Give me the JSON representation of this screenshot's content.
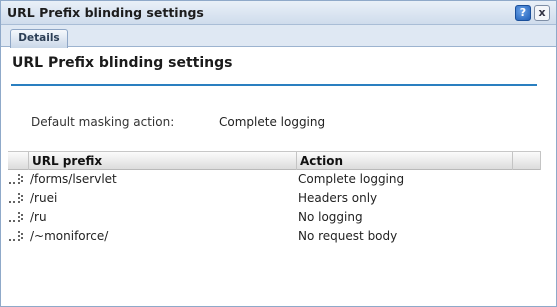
{
  "window": {
    "title": "URL Prefix blinding settings",
    "help_icon": "help-icon",
    "help_glyph": "?",
    "close_icon": "close-icon",
    "close_glyph": "x"
  },
  "tabs": [
    {
      "label": "Details",
      "active": true
    }
  ],
  "page": {
    "heading": "URL Prefix blinding settings",
    "accent_color": "#2a7fc0"
  },
  "default_masking": {
    "label": "Default masking action:",
    "value": "Complete logging"
  },
  "table": {
    "columns": [
      "URL prefix",
      "Action"
    ],
    "rows": [
      {
        "prefix": "/forms/lservlet",
        "action": "Complete logging"
      },
      {
        "prefix": "/ruei",
        "action": "Headers only"
      },
      {
        "prefix": "/ru",
        "action": "No logging"
      },
      {
        "prefix": "/~moniforce/",
        "action": "No request body"
      }
    ]
  }
}
